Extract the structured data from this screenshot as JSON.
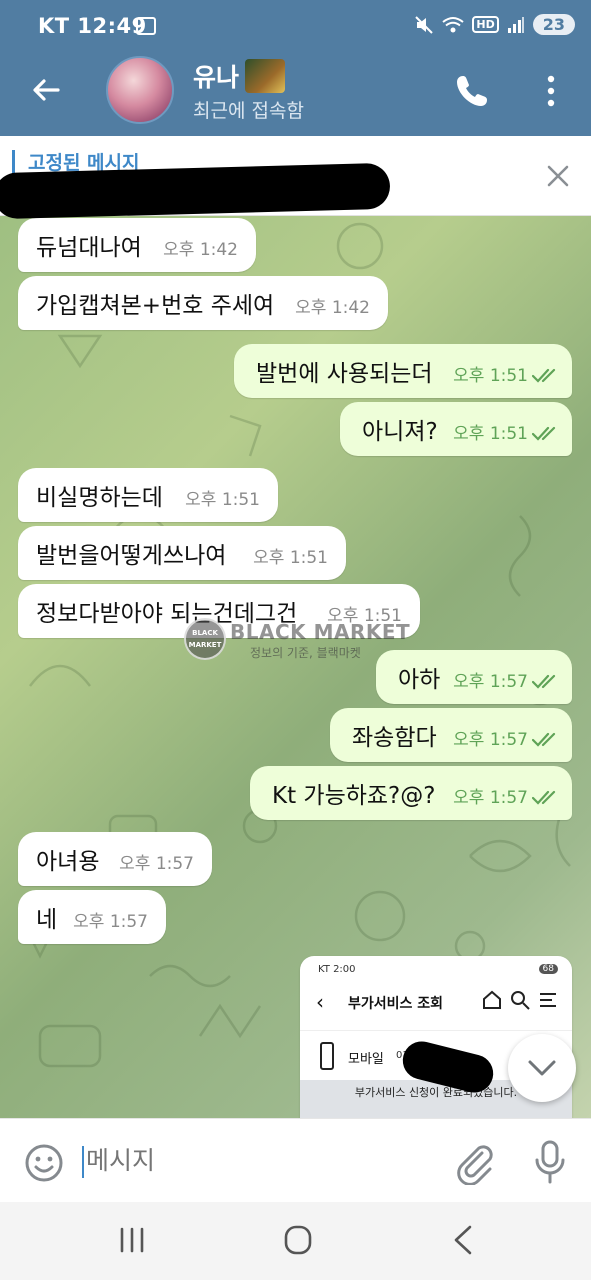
{
  "status_bar": {
    "carrier": "KT",
    "time": "12:49",
    "battery": "23",
    "hd_label": "HD"
  },
  "header": {
    "contact_name": "유나",
    "last_seen": "최근에 접속함"
  },
  "pinned": {
    "label": "고정된 메시지"
  },
  "messages": [
    {
      "side": "in",
      "text": "듀넘대나여",
      "time": "오후 1:42"
    },
    {
      "side": "in",
      "text": "가입캡쳐본+번호 주세여",
      "time": "오후 1:42"
    },
    {
      "side": "out",
      "text": "발번에 사용되는더",
      "time": "오후 1:51",
      "read": true
    },
    {
      "side": "out",
      "text": "아니져?",
      "time": "오후 1:51",
      "read": true
    },
    {
      "side": "in",
      "text": "비실명하는데",
      "time": "오후 1:51"
    },
    {
      "side": "in",
      "text": "발번을어떻게쓰나여",
      "time": "오후 1:51"
    },
    {
      "side": "in",
      "text": "정보다받아야 되는건데그건",
      "time": "오후 1:51"
    },
    {
      "side": "out",
      "text": "아하",
      "time": "오후 1:57",
      "read": true
    },
    {
      "side": "out",
      "text": "좌송함다",
      "time": "오후 1:57",
      "read": true
    },
    {
      "side": "out",
      "text": "Kt 가능하죠?@?",
      "time": "오후 1:57",
      "read": true
    },
    {
      "side": "in",
      "text": "아녀용",
      "time": "오후 1:57"
    },
    {
      "side": "in",
      "text": "네",
      "time": "오후 1:57"
    }
  ],
  "watermark": {
    "logo_text": "BLACK MARKET",
    "title": "BLACK MARKET",
    "subtitle": "정보의 기준, 블랙마켓"
  },
  "screenshot_card": {
    "status": "KT 2:00",
    "battery": "68",
    "title": "부가서비스 조회",
    "item_label": "모바일",
    "number_prefix": "010",
    "notice": "부가서비스 신청이 완료되었습니다."
  },
  "composer": {
    "placeholder": "메시지"
  },
  "icons": {
    "back": "arrow-left-icon",
    "call": "phone-icon",
    "menu": "more-vertical-icon",
    "close": "close-icon",
    "emoji": "emoji-icon",
    "attach": "paperclip-icon",
    "mic": "microphone-icon",
    "scroll": "chevron-down-icon",
    "read": "double-check-icon"
  },
  "colors": {
    "header": "#517da2",
    "accent": "#3e88c8",
    "outgoing_bubble": "#eefed9",
    "incoming_bubble": "#ffffff",
    "read_check": "#5fa357"
  }
}
